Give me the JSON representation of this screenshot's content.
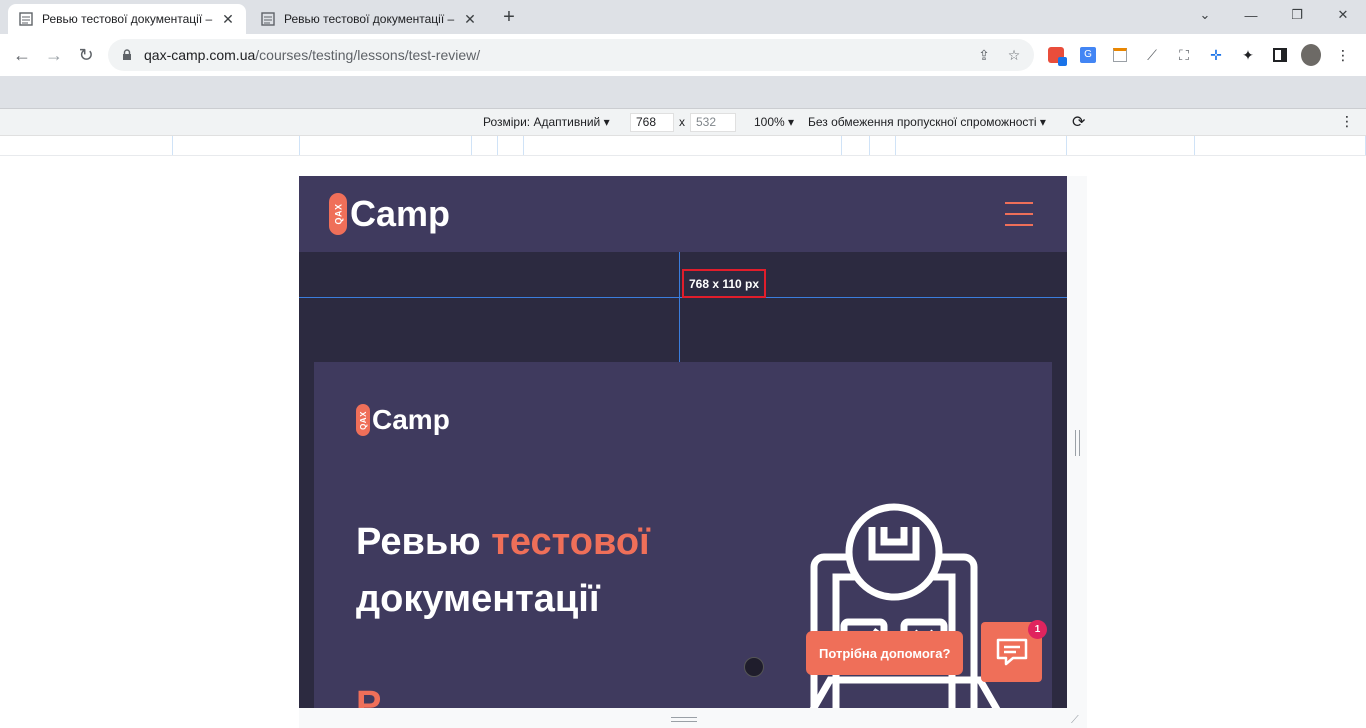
{
  "tabs": [
    {
      "title": "Ревью тестової документації –",
      "active": true
    },
    {
      "title": "Ревью тестової документації –",
      "active": false
    }
  ],
  "omnibox": {
    "host": "qax-camp.com.ua",
    "path": "/courses/testing/lessons/test-review/"
  },
  "extensions": [
    "ext-red-icon",
    "translate-icon",
    "notes-icon",
    "ruler-icon",
    "screenshot-icon",
    "move-icon",
    "puzzle-icon",
    "sidepanel-icon",
    "avatar"
  ],
  "devtools": {
    "dimensions_label": "Розміри: Адаптивний",
    "width": "768",
    "times": "x",
    "height": "532",
    "zoom": "100%",
    "throttling": "Без обмеження пропускної спроможності"
  },
  "site": {
    "logo_badge": "QAX",
    "logo_text": "Camp",
    "element_size_label": "768 x 110 px",
    "hero_title_part1": "Ревью ",
    "hero_title_accent": "тестової",
    "hero_title_part2": "документації",
    "hero_letter": "Р",
    "help_label": "Потрібна допомога?",
    "chat_badge_count": "1"
  },
  "colors": {
    "accent": "#ef6f59",
    "header_bg": "#3f3a5e",
    "page_bg": "#2c2a40"
  }
}
